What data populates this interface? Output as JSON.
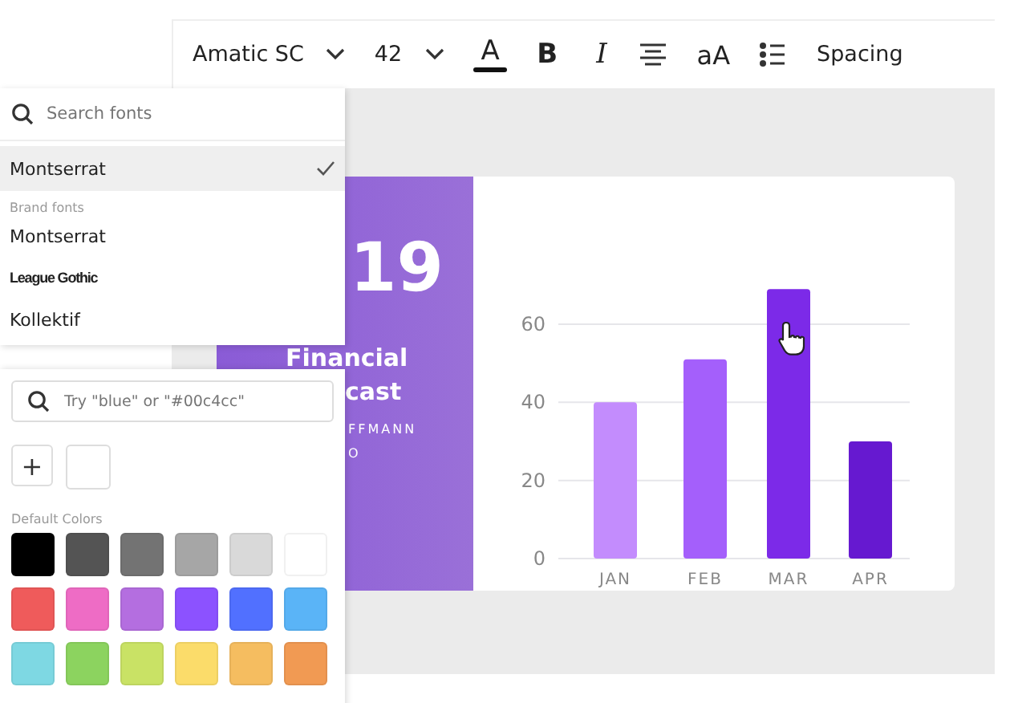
{
  "toolbar": {
    "font": "Amatic SC",
    "size": "42",
    "spacing": "Spacing",
    "case_label": "aA",
    "color_letter": "A",
    "bold_letter": "B",
    "italic_letter": "I"
  },
  "font_menu": {
    "placeholder": "Search fonts",
    "current": [
      {
        "label": "Montserrat",
        "selected": true
      }
    ],
    "group_label": "Brand fonts",
    "brand_fonts": [
      {
        "label": "Montserrat",
        "kind": "regular",
        "selected": false
      },
      {
        "label": "League Gothic",
        "kind": "condensed",
        "selected": false
      },
      {
        "label": "Kollektif",
        "kind": "regular",
        "selected": false
      }
    ]
  },
  "color_panel": {
    "placeholder": "Try \"blue\" or \"#00c4cc\"",
    "add_label": "+",
    "group_label": "Default Colors",
    "swatches": [
      {
        "color": "#000000"
      },
      {
        "color": "#545454"
      },
      {
        "color": "#737373"
      },
      {
        "color": "#a6a6a6"
      },
      {
        "color": "#d9d9d9"
      },
      {
        "color": "#ffffff"
      },
      {
        "color": "#ef5b5b"
      },
      {
        "color": "#ee6cc5"
      },
      {
        "color": "#b46ee0"
      },
      {
        "color": "#8c52ff"
      },
      {
        "color": "#5170ff"
      },
      {
        "color": "#5ab4f7"
      },
      {
        "color": "#7ed8e3"
      },
      {
        "color": "#8cd35f"
      },
      {
        "color": "#c9e265"
      },
      {
        "color": "#fbdc6a"
      },
      {
        "color": "#f5bd60"
      },
      {
        "color": "#f19a53"
      }
    ]
  },
  "slide": {
    "year": "19",
    "title_lines": [
      "Financial",
      "cast"
    ],
    "byline_lines": [
      "FFMANN",
      "O"
    ],
    "chart_data": {
      "type": "bar",
      "categories": [
        "JAN",
        "FEB",
        "MAR",
        "APR"
      ],
      "values": [
        40,
        51,
        69,
        30
      ],
      "ylim": [
        0,
        70
      ],
      "yticks": [
        0,
        20,
        40,
        60
      ],
      "grid": true
    }
  }
}
